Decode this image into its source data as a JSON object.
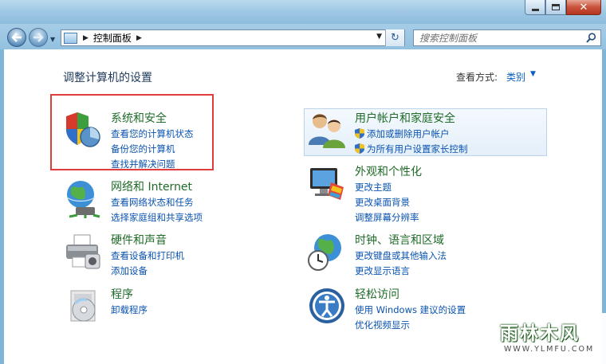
{
  "window": {
    "minimize_glyph": "–",
    "maximize_glyph": "□",
    "close_glyph": "✕"
  },
  "nav": {
    "back_icon": "left-arrow-icon",
    "forward_icon": "right-arrow-icon",
    "address": "控制面板",
    "search_placeholder": "搜索控制面板"
  },
  "header": {
    "title": "调整计算机的设置",
    "view_by_label": "查看方式:",
    "view_by_value": "类别"
  },
  "categories": [
    {
      "title": "系统和安全",
      "icon": "shield-icon",
      "links": [
        "查看您的计算机状态",
        "备份您的计算机",
        "查找并解决问题"
      ],
      "highlight_color": "#e03c3c"
    },
    {
      "title": "网络和 Internet",
      "icon": "network-globe-icon",
      "links": [
        "查看网络状态和任务",
        "选择家庭组和共享选项"
      ]
    },
    {
      "title": "硬件和声音",
      "icon": "printer-icon",
      "links": [
        "查看设备和打印机",
        "添加设备"
      ]
    },
    {
      "title": "程序",
      "icon": "programs-disc-icon",
      "links": [
        "卸载程序"
      ]
    },
    {
      "title": "用户帐户和家庭安全",
      "icon": "users-icon",
      "links": [
        "添加或删除用户帐户",
        "为所有用户设置家长控制"
      ]
    },
    {
      "title": "外观和个性化",
      "icon": "monitor-paint-icon",
      "links": [
        "更改主题",
        "更改桌面背景",
        "调整屏幕分辨率"
      ]
    },
    {
      "title": "时钟、语言和区域",
      "icon": "clock-globe-icon",
      "links": [
        "更改键盘或其他输入法",
        "更改显示语言"
      ]
    },
    {
      "title": "轻松访问",
      "icon": "ease-of-access-icon",
      "links": [
        "使用 Windows 建议的设置",
        "优化视频显示"
      ]
    }
  ],
  "watermark": {
    "name": "雨林木风",
    "url": "WWW.YLMFU.COM"
  },
  "colors": {
    "title_green": "#1f6b28",
    "link_blue": "#0a53b0",
    "highlight_red": "#e03c3c"
  }
}
